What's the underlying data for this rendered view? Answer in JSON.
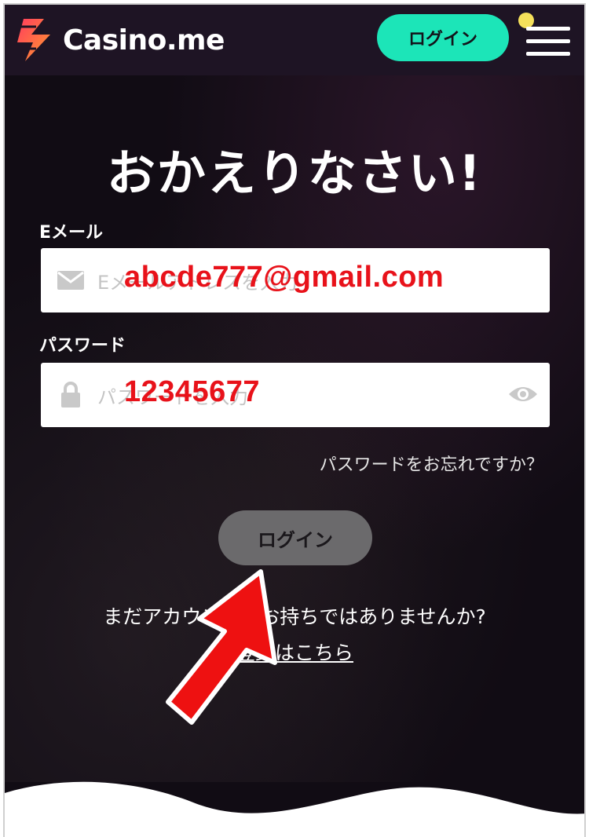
{
  "header": {
    "logo_text": "Casino.me",
    "login_button": "ログイン",
    "notification_color": "#f5e05a",
    "accent_color": "#1ce5b8"
  },
  "form": {
    "title": "おかえりなさい!",
    "email": {
      "label": "Eメール",
      "placeholder": "Eメールアドレスを入力",
      "value": "abcde777@gmail.com",
      "icon": "envelope-icon"
    },
    "password": {
      "label": "パスワード",
      "placeholder": "パスワードを入力",
      "value": "12345677",
      "icon": "lock-icon",
      "toggle_icon": "eye-icon"
    },
    "forgot_password": "パスワードをお忘れですか？",
    "submit_button": "ログイン",
    "no_account_text": "まだアカウントをお持ちではありませんか?",
    "register_link": "登録はこちら"
  },
  "annotation": {
    "arrow_color": "#ee1111",
    "value_text_color": "#e8121a"
  }
}
